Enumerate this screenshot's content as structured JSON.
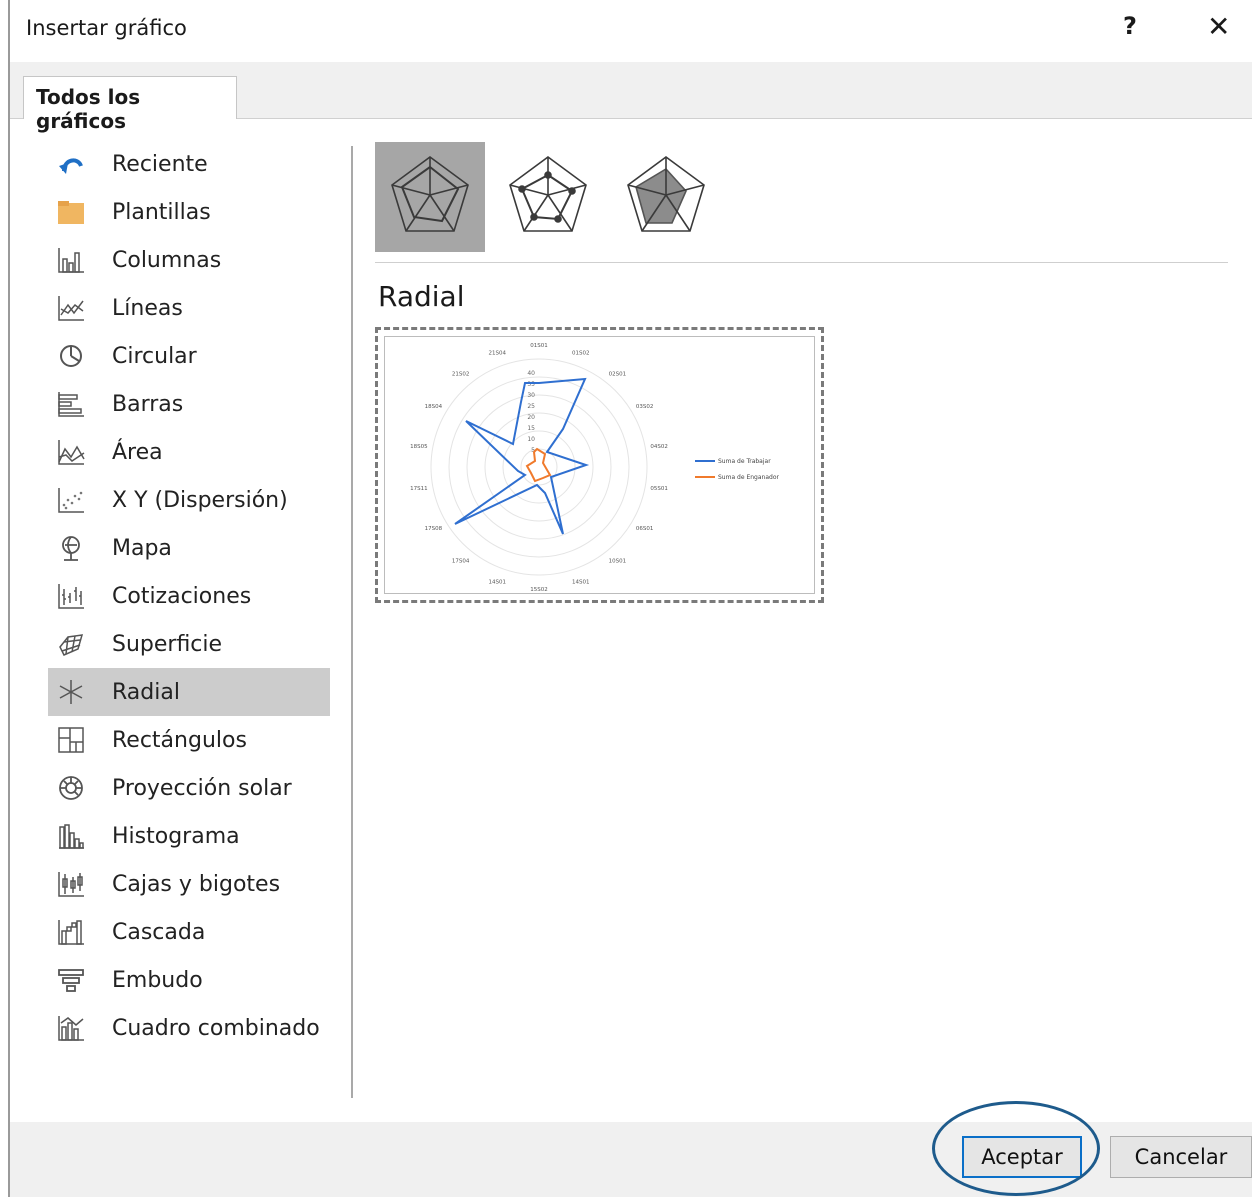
{
  "dialog": {
    "title": "Insertar gráfico",
    "help_label": "?",
    "close_label": "✕"
  },
  "tab": {
    "label": "Todos los gráficos"
  },
  "sidebar": {
    "items": [
      {
        "label": "Reciente",
        "icon": "recent-icon"
      },
      {
        "label": "Plantillas",
        "icon": "templates-folder-icon"
      },
      {
        "label": "Columnas",
        "icon": "column-chart-icon"
      },
      {
        "label": "Líneas",
        "icon": "line-chart-icon"
      },
      {
        "label": "Circular",
        "icon": "pie-chart-icon"
      },
      {
        "label": "Barras",
        "icon": "bar-chart-icon"
      },
      {
        "label": "Área",
        "icon": "area-chart-icon"
      },
      {
        "label": "X Y (Dispersión)",
        "icon": "scatter-chart-icon"
      },
      {
        "label": "Mapa",
        "icon": "map-icon"
      },
      {
        "label": "Cotizaciones",
        "icon": "stock-chart-icon"
      },
      {
        "label": "Superficie",
        "icon": "surface-chart-icon"
      },
      {
        "label": "Radial",
        "icon": "radar-chart-icon"
      },
      {
        "label": "Rectángulos",
        "icon": "treemap-icon"
      },
      {
        "label": "Proyección solar",
        "icon": "sunburst-icon"
      },
      {
        "label": "Histograma",
        "icon": "histogram-icon"
      },
      {
        "label": "Cajas y bigotes",
        "icon": "box-whisker-icon"
      },
      {
        "label": "Cascada",
        "icon": "waterfall-icon"
      },
      {
        "label": "Embudo",
        "icon": "funnel-icon"
      },
      {
        "label": "Cuadro combinado",
        "icon": "combo-chart-icon"
      }
    ],
    "selected_index": 11
  },
  "subtypes": [
    {
      "name": "radar",
      "icon": "radar-icon"
    },
    {
      "name": "radar-markers",
      "icon": "radar-markers-icon"
    },
    {
      "name": "filled-radar",
      "icon": "filled-radar-icon"
    }
  ],
  "main": {
    "subtitle": "Radial"
  },
  "preview": {
    "axis_ticks": [
      "5",
      "10",
      "15",
      "20",
      "25",
      "30",
      "35",
      "40"
    ],
    "categories": [
      "01S01",
      "01S02",
      "02S01",
      "03S02",
      "04S02",
      "05S01",
      "06S01",
      "10S01",
      "14S01",
      "15S02",
      "14S01",
      "17S04",
      "17S08",
      "17S11",
      "18S05",
      "18S04",
      "21S02",
      "21S04"
    ],
    "legend": [
      "Suma de Trabajar",
      "Suma de Enganador"
    ],
    "colors": {
      "series1": "#2f6fd0",
      "series2": "#f07a2c"
    }
  },
  "footer": {
    "ok_label": "Aceptar",
    "cancel_label": "Cancelar"
  },
  "colors": {
    "selection_bg": "#cccccc",
    "accent": "#0a6fc8",
    "annotation_ring": "#1e5b8c"
  }
}
